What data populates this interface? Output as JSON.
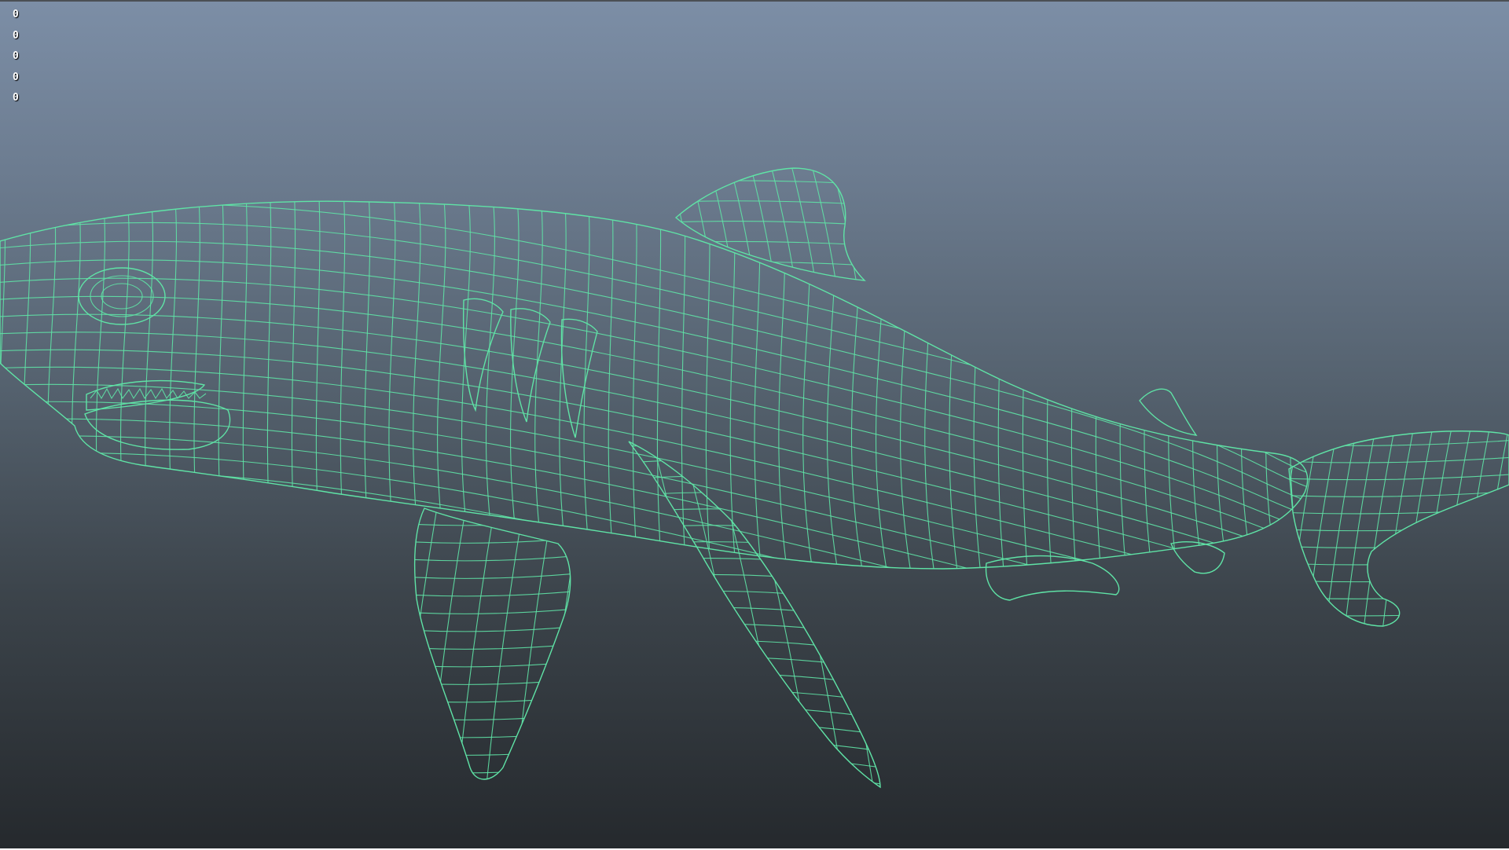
{
  "viewport": {
    "hud_counters": [
      "0",
      "0",
      "0",
      "0",
      "0"
    ],
    "bottom_label": "",
    "background_top": "#7c8ea6",
    "background_bottom": "#25292d"
  },
  "model": {
    "subject": "shark",
    "display_mode": "smooth-shaded-wireframe-on-shaded",
    "wire_color": "#5fe3a6",
    "shade_color": "#5a5a5a"
  }
}
